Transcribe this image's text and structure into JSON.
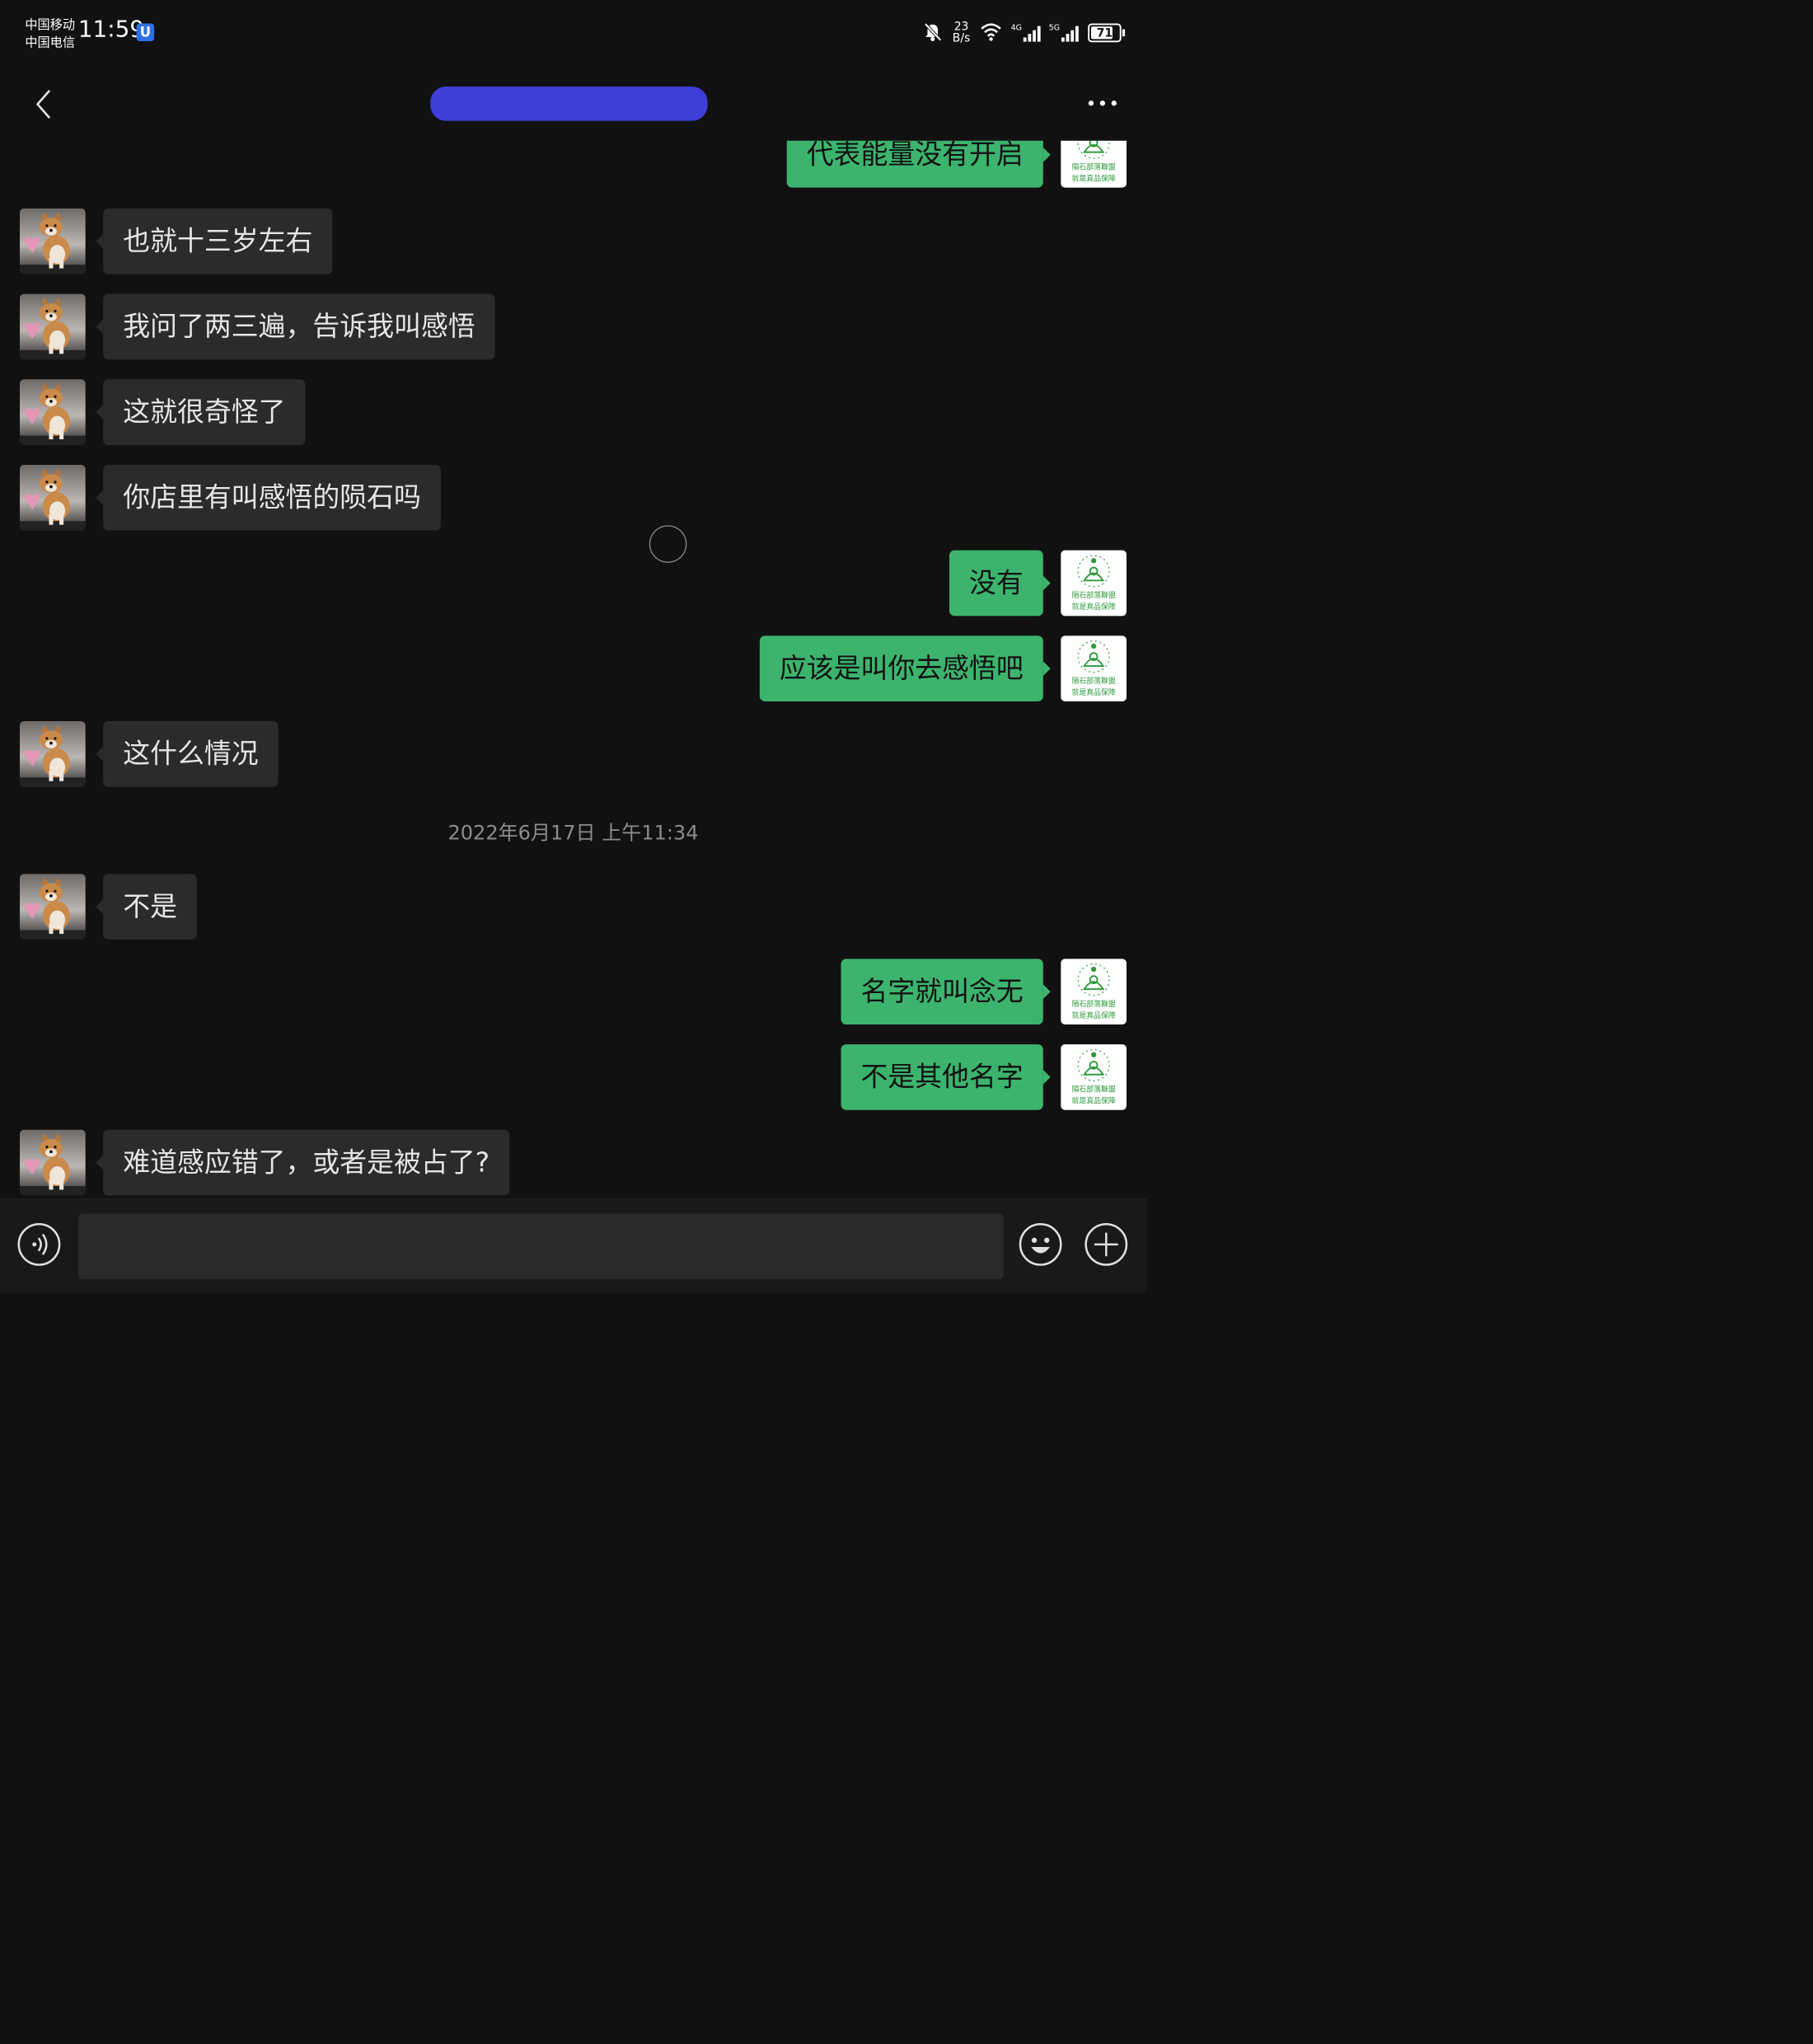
{
  "status_bar": {
    "carrier_1": "中国移动",
    "carrier_2": "中国电信",
    "time": "11:59",
    "app_badge": "U",
    "net_speed_value": "23",
    "net_speed_unit": "B/s",
    "signal_1_tag": "4G",
    "signal_2_tag": "5G",
    "battery_level": "71",
    "icons": [
      "bell-muted-icon",
      "wifi-icon",
      "signal-4g-icon",
      "signal-5g-icon",
      "battery-icon"
    ]
  },
  "header": {
    "back_icon": "chevron-left-icon",
    "more_icon": "more-dots-icon",
    "title_redaction_color": "#3d3fd8"
  },
  "messages": [
    {
      "side": "out",
      "text": "代表能量没有开启",
      "avatar": "meteorite-alliance-logo"
    },
    {
      "side": "in",
      "text": "也就十三岁左右",
      "avatar": "shiba-dog-avatar"
    },
    {
      "side": "in",
      "text": "我问了两三遍，告诉我叫感悟",
      "avatar": "shiba-dog-avatar"
    },
    {
      "side": "in",
      "text": "这就很奇怪了",
      "avatar": "shiba-dog-avatar"
    },
    {
      "side": "in",
      "text": "你店里有叫感悟的陨石吗",
      "avatar": "shiba-dog-avatar"
    },
    {
      "side": "out",
      "text": "没有",
      "avatar": "meteorite-alliance-logo"
    },
    {
      "side": "out",
      "text": "应该是叫你去感悟吧",
      "avatar": "meteorite-alliance-logo"
    },
    {
      "side": "in",
      "text": "这什么情况",
      "avatar": "shiba-dog-avatar"
    },
    {
      "side": "in",
      "text": "不是",
      "avatar": "shiba-dog-avatar"
    },
    {
      "side": "out",
      "text": "名字就叫念无",
      "avatar": "meteorite-alliance-logo"
    },
    {
      "side": "out",
      "text": "不是其他名字",
      "avatar": "meteorite-alliance-logo"
    },
    {
      "side": "in",
      "text": "难道感应错了，或者是被占了?",
      "avatar": "shiba-dog-avatar"
    }
  ],
  "timestamp": "2022年6月17日 上午11:34",
  "logo": {
    "line_1": "隕石部落聯盟",
    "line_2": "就是真品保障"
  },
  "colors": {
    "background": "#111111",
    "incoming_bubble": "#2b2b2b",
    "outgoing_bubble": "#3cb46e",
    "logo_green": "#2f9a3c"
  },
  "input_bar": {
    "voice_icon": "voice-icon",
    "emoji_icon": "emoji-icon",
    "plus_icon": "plus-circle-icon",
    "input_value": ""
  }
}
